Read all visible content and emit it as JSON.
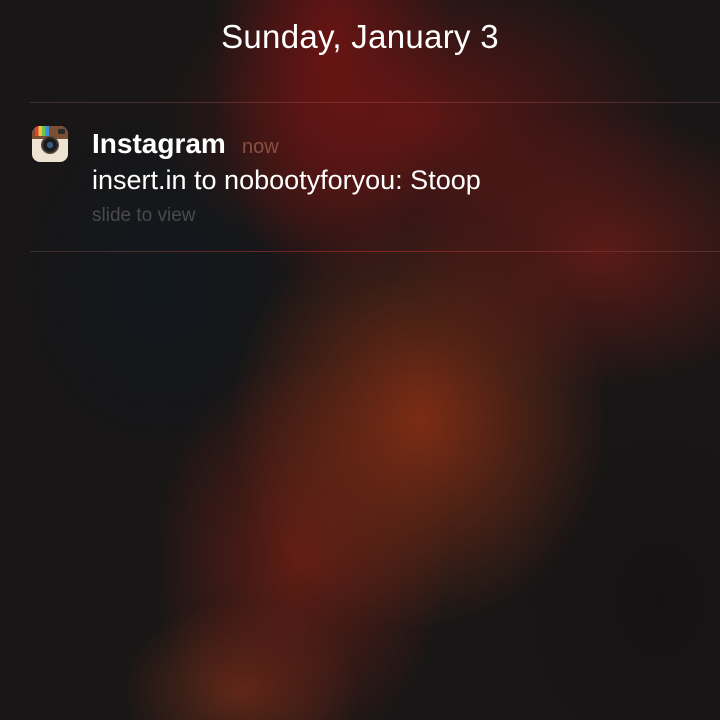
{
  "lock_screen": {
    "date": "Sunday, January 3"
  },
  "notification": {
    "app_name": "Instagram",
    "app_icon": "instagram-camera-icon",
    "time": "now",
    "message": "insert.in to nobootyforyou: Stoop",
    "action_hint": "slide to view"
  },
  "colors": {
    "background": "#171717",
    "text_primary": "#ffffff",
    "time_label": "#8a4f44",
    "hint_text": "#4a4a4a",
    "divider_accent": "#a02828"
  }
}
